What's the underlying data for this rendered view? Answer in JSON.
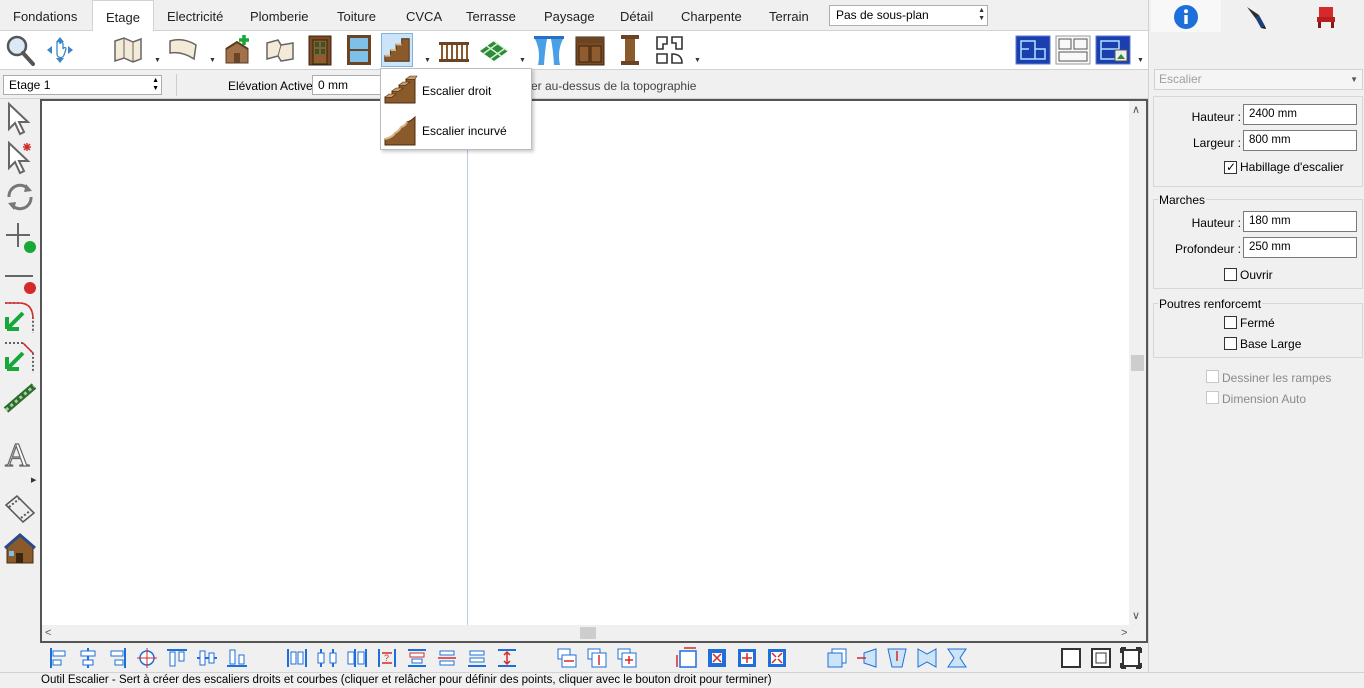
{
  "tabs": [
    "Fondations",
    "Etage",
    "Electricité",
    "Plomberie",
    "Toiture",
    "CVCA",
    "Terrasse",
    "Paysage",
    "Détail",
    "Charpente",
    "Terrain"
  ],
  "active_tab": "Etage",
  "subplan": {
    "value": "Pas de sous-plan"
  },
  "toolbar": {
    "icons": [
      "zoom-icon",
      "pan-icon",
      "wall-icon",
      "curved-wall-icon",
      "add-room-icon",
      "room-shape-icon",
      "door-icon",
      "window-icon",
      "stairs-icon",
      "railing-icon",
      "floor-pattern-icon",
      "curtain-icon",
      "cabinet-icon",
      "column-icon",
      "shape-tool-icon",
      "view-plan-icon",
      "view-elevation-icon",
      "view-3d-icon"
    ]
  },
  "options": {
    "floor_select": "Etage 1",
    "elevation_label": "Elévation Active:",
    "elevation_value": "0 mm",
    "topo_text": "er au-dessus de la topographie"
  },
  "stairs_menu": {
    "items": [
      {
        "label": "Escalier droit",
        "icon": "straight-stair-icon"
      },
      {
        "label": "Escalier incurvé",
        "icon": "curved-stair-icon"
      }
    ]
  },
  "left_tools": [
    "select-arrow-icon",
    "select-edit-icon",
    "rotate-icon",
    "add-point-icon",
    "split-line-icon",
    "fillet-icon",
    "chamfer-icon",
    "path-icon",
    "text-icon",
    "film-icon",
    "house-icon"
  ],
  "right_panel": {
    "tabs": [
      "info-icon",
      "pen-icon",
      "furniture-icon"
    ],
    "object_type": "Escalier",
    "height_label": "Hauteur :",
    "height_value": "2400 mm",
    "width_label": "Largeur :",
    "width_value": "800 mm",
    "habillage_label": "Habillage d'escalier",
    "habillage_checked": true,
    "marches": {
      "title": "Marches",
      "height_label": "Hauteur :",
      "height_value": "180 mm",
      "depth_label": "Profondeur :",
      "depth_value": "250 mm",
      "open_label": "Ouvrir"
    },
    "poutres": {
      "title": "Poutres renforcemt",
      "closed_label": "Fermé",
      "wide_base_label": "Base Large"
    },
    "draw_ramps_label": "Dessiner les rampes",
    "auto_dim_label": "Dimension Auto"
  },
  "status_text": "Outil Escalier - Sert à créer des escaliers droits et courbes (cliquer et relâcher pour définir des points, cliquer avec le bouton droit pour terminer)",
  "colors": {
    "accent": "#1e6fd9",
    "selection": "#cce4f7",
    "wood": "#8b5a2b",
    "red": "#d42a2a",
    "green": "#18a83a"
  }
}
